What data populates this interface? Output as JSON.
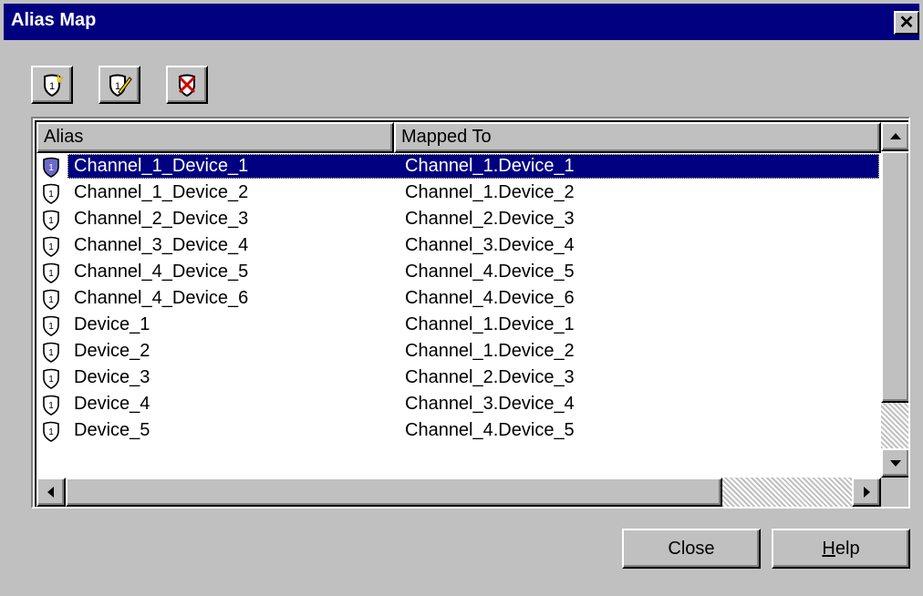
{
  "window": {
    "title": "Alias Map"
  },
  "toolbar": {
    "buttons": [
      {
        "icon": "new-alias-icon"
      },
      {
        "icon": "edit-alias-icon"
      },
      {
        "icon": "delete-alias-icon"
      }
    ]
  },
  "list": {
    "columns": [
      "Alias",
      "Mapped To"
    ],
    "selected_index": 0,
    "rows": [
      {
        "alias": "Channel_1_Device_1",
        "mapped": "Channel_1.Device_1"
      },
      {
        "alias": "Channel_1_Device_2",
        "mapped": "Channel_1.Device_2"
      },
      {
        "alias": "Channel_2_Device_3",
        "mapped": "Channel_2.Device_3"
      },
      {
        "alias": "Channel_3_Device_4",
        "mapped": "Channel_3.Device_4"
      },
      {
        "alias": "Channel_4_Device_5",
        "mapped": "Channel_4.Device_5"
      },
      {
        "alias": "Channel_4_Device_6",
        "mapped": "Channel_4.Device_6"
      },
      {
        "alias": "Device_1",
        "mapped": "Channel_1.Device_1"
      },
      {
        "alias": "Device_2",
        "mapped": "Channel_1.Device_2"
      },
      {
        "alias": "Device_3",
        "mapped": "Channel_2.Device_3"
      },
      {
        "alias": "Device_4",
        "mapped": "Channel_3.Device_4"
      },
      {
        "alias": "Device_5",
        "mapped": "Channel_4.Device_5"
      }
    ]
  },
  "buttons": {
    "close": "Close",
    "help_mnemonic": "H",
    "help_rest": "elp"
  },
  "colors": {
    "titlebar": "#000080",
    "selection": "#000080",
    "face": "#c0c0c0"
  }
}
